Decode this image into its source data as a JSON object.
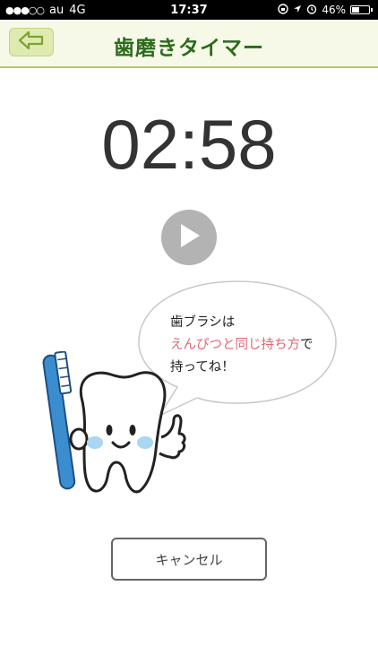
{
  "status_bar": {
    "signal_dots": "●●●○○",
    "carrier": "au",
    "network": "4G",
    "time": "17:37",
    "battery_percent": "46%",
    "battery_level": 0.46,
    "icons": [
      "rotation-lock-icon",
      "location-icon",
      "alarm-icon",
      "battery-icon"
    ]
  },
  "header": {
    "title": "歯磨きタイマー",
    "back_icon": "back-arrow-icon"
  },
  "timer": {
    "value": "02:58"
  },
  "play_button": {
    "icon": "play-icon"
  },
  "speech_bubble": {
    "line1": "歯ブラシは",
    "line2_accent": "えんぴつと同じ持ち方",
    "line2_rest": "で",
    "line3": "持ってね！"
  },
  "cancel_button": {
    "label": "キャンセル"
  },
  "colors": {
    "header_bg": "#f7f9e8",
    "header_border": "#b6c96a",
    "title": "#2c6b1c",
    "accent_text": "#e06673",
    "play_button": "#b3b3b3",
    "toothbrush": "#3a8ed0"
  }
}
